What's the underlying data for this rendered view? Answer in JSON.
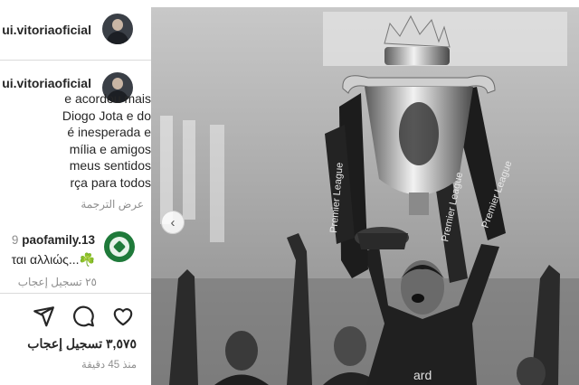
{
  "author": {
    "username": "ui.vitoriaoficial",
    "username_caption": "ui.vitoriaoficial"
  },
  "caption_lines": [
    "e acordou mais",
    "Diogo Jota e do",
    "é inesperada e",
    "mília e amigos",
    "meus sentidos",
    "rça para todos"
  ],
  "translate_link": "عرض الترجمة",
  "comment": {
    "prefix": "9",
    "username": "paofamily.13",
    "text": "ται αλλιώς...☘️",
    "likes": "٢٥ تسجيل إعجاب"
  },
  "post": {
    "likes": "٣,٥٧٥ تسجيل إعجاب",
    "time": "منذ 45 دقيقة"
  },
  "photo": {
    "trophy_text": "Premier League",
    "shirt_text": "ard"
  },
  "icons": [
    "share-icon",
    "comment-icon",
    "heart-icon",
    "chevron-left-icon"
  ]
}
